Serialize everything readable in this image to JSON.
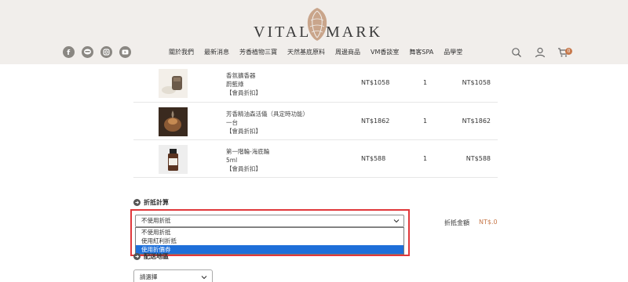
{
  "header": {
    "logo": {
      "left": "VITAL",
      "right": "MARK"
    },
    "social": [
      {
        "name": "facebook-icon",
        "glyph": "f"
      },
      {
        "name": "line-icon",
        "glyph": "L"
      },
      {
        "name": "instagram-icon",
        "glyph": "◎"
      },
      {
        "name": "youtube-icon",
        "glyph": "▶"
      }
    ],
    "nav": [
      "關於我們",
      "最新消息",
      "芳香植物三寶",
      "天然基底原料",
      "周邊商品",
      "VM香談室",
      "舞客SPA",
      "品學堂"
    ],
    "cart_count": "0"
  },
  "products": [
    {
      "name": "香氛擴香器",
      "spec": "蔚藍綠",
      "tag": "【會員折扣】",
      "price": "NT$1058",
      "qty": "1",
      "subtotal": "NT$1058"
    },
    {
      "name": "芳香精油森活儀（具定時功能）",
      "spec": "一台",
      "tag": "【會員折扣】",
      "price": "NT$1862",
      "qty": "1",
      "subtotal": "NT$1862"
    },
    {
      "name": "第一階輪-海底輪",
      "spec": "5ml",
      "tag": "【會員折扣】",
      "price": "NT$588",
      "qty": "1",
      "subtotal": "NT$588"
    }
  ],
  "discount": {
    "title": "折抵計算",
    "selected": "不使用折抵",
    "options": [
      "不使用折抵",
      "使用紅利折抵",
      "使用折價券"
    ],
    "highlighted_option": "使用折價券",
    "amount_label": "折抵金額",
    "amount_value": "NT$.0"
  },
  "delivery": {
    "title": "配送地區",
    "placeholder": "請選擇"
  },
  "colors": {
    "header_bg": "#f1eeeb",
    "accent": "#c7794c",
    "highlight_border": "#e0383b",
    "option_selected": "#1e6fd9"
  }
}
